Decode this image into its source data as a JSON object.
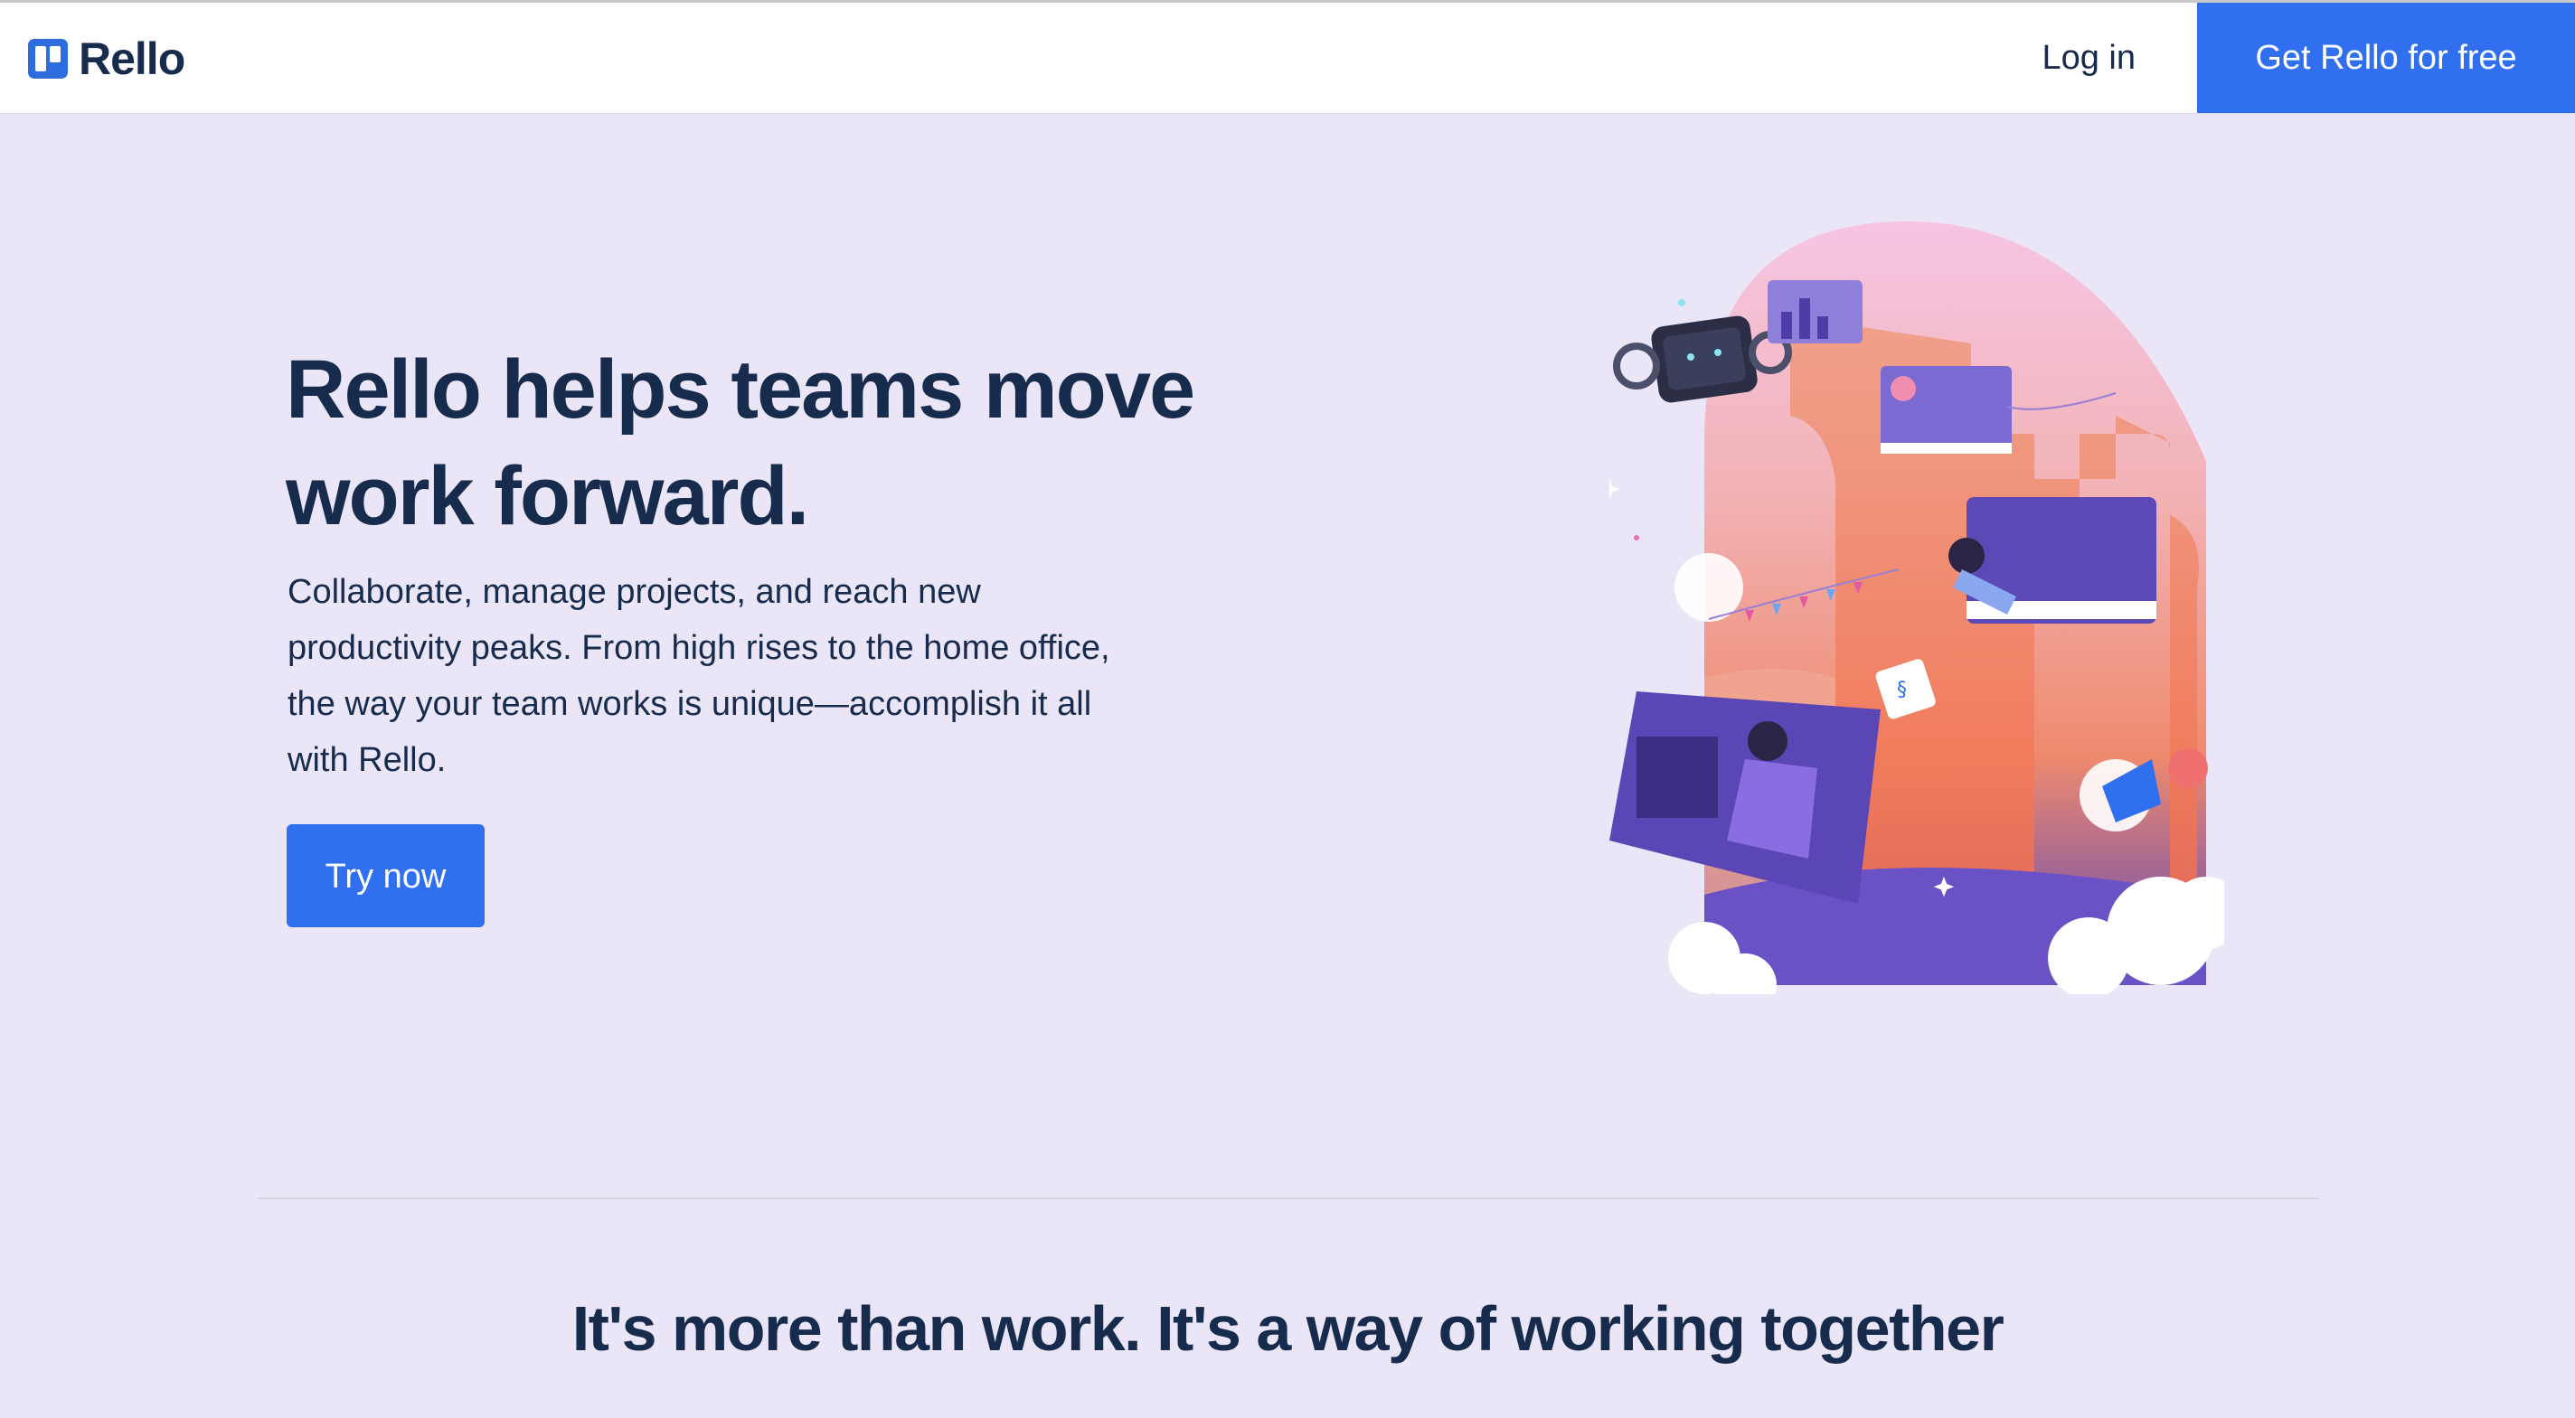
{
  "nav": {
    "brand": "Rello",
    "login_label": "Log in",
    "cta_label": "Get Rello for free"
  },
  "hero": {
    "title": "Rello helps teams move work forward.",
    "description": "Collaborate, manage projects, and reach new productivity peaks. From high rises to the home office, the way your team works is unique—accomplish it all with Rello.",
    "button_label": "Try now"
  },
  "section": {
    "heading": "It's more than work. It's a way of working together"
  },
  "colors": {
    "page_bg": "#eae6f8",
    "primary": "#2f6ff0",
    "text": "#172b4d"
  }
}
